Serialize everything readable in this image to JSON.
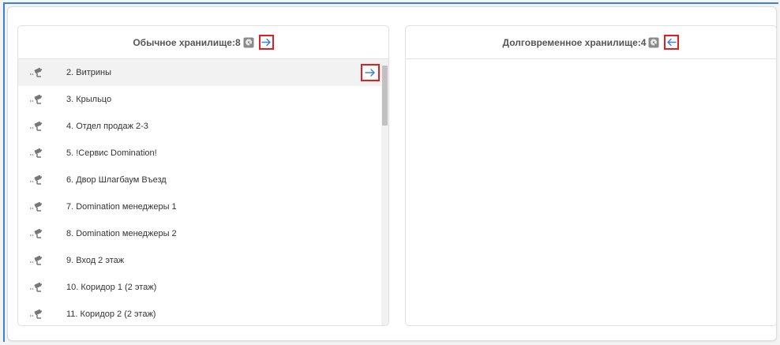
{
  "left_panel": {
    "title": "Обычное хранилище:8",
    "icons": {
      "storage": "hdd-icon",
      "action": "arrow-right-icon"
    },
    "items": [
      {
        "label": "2. Витрины"
      },
      {
        "label": "3. Крыльцо"
      },
      {
        "label": "4. Отдел продаж 2-3"
      },
      {
        "label": "5. !Сервис Domination!"
      },
      {
        "label": "6. Двор Шлагбаум Въезд"
      },
      {
        "label": "7. Domination менеджеры 1"
      },
      {
        "label": "8. Domination менеджеры 2"
      },
      {
        "label": "9. Вход 2 этаж"
      },
      {
        "label": "10. Коридор 1 (2 этаж)"
      },
      {
        "label": "11. Коридор 2 (2 этаж)"
      }
    ]
  },
  "right_panel": {
    "title": "Долговременное хранилище:4",
    "icons": {
      "storage": "hdd-icon",
      "action": "arrow-left-icon"
    }
  },
  "colors": {
    "accent_blue": "#3c82d8",
    "highlight_red": "#e01f1f",
    "icon_gray": "#777777"
  }
}
